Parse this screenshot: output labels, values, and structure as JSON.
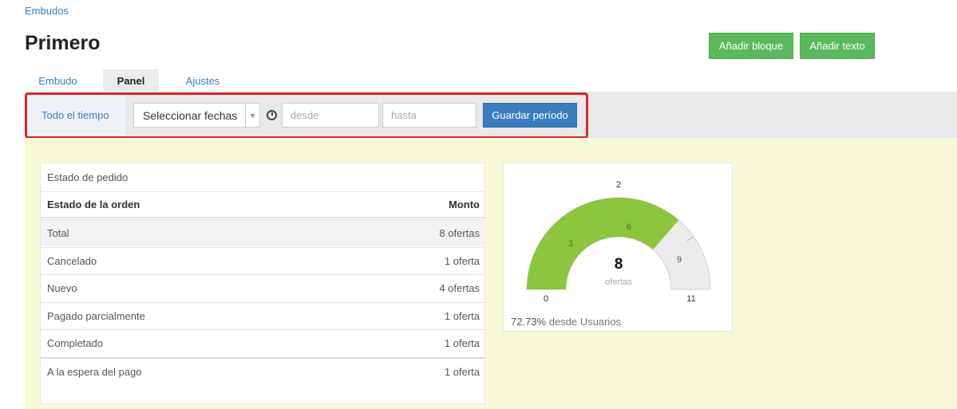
{
  "breadcrumb": "Embudos",
  "title": "Primero",
  "actions": {
    "add_block": "Añadir bloque",
    "add_text": "Añadir texto"
  },
  "tabs": [
    {
      "label": "Embudo",
      "active": false
    },
    {
      "label": "Panel",
      "active": true
    },
    {
      "label": "Ajustes",
      "active": false
    }
  ],
  "filter": {
    "all_time": "Todo el tiempo",
    "select_dates": "Seleccionar fechas",
    "from_placeholder": "desde",
    "to_placeholder": "hasta",
    "save_label": "Guardar período"
  },
  "order_status": {
    "title": "Estado de pedido",
    "columns": [
      "Estado de la orden",
      "Monto"
    ],
    "rows": [
      {
        "label": "Total",
        "value": "8 ofertas"
      },
      {
        "label": "Cancelado",
        "value": "1 oferta"
      },
      {
        "label": "Nuevo",
        "value": "4 ofertas"
      },
      {
        "label": "Pagado parcialmente",
        "value": "1 oferta"
      },
      {
        "label": "Completado",
        "value": "1 oferta"
      },
      {
        "label": "A la espera del pago",
        "value": "1 oferta"
      }
    ]
  },
  "gauge": {
    "value": "8",
    "unit": "ofertas",
    "min": 0,
    "max": 11,
    "fill_value": 8,
    "tick_labels": [
      "0",
      "2",
      "3",
      "6",
      "9",
      "11"
    ],
    "footer_percent": "72.73%",
    "footer_text": "desde Usuarios",
    "fill_color": "#8cc63f",
    "track_color": "#ececec"
  }
}
